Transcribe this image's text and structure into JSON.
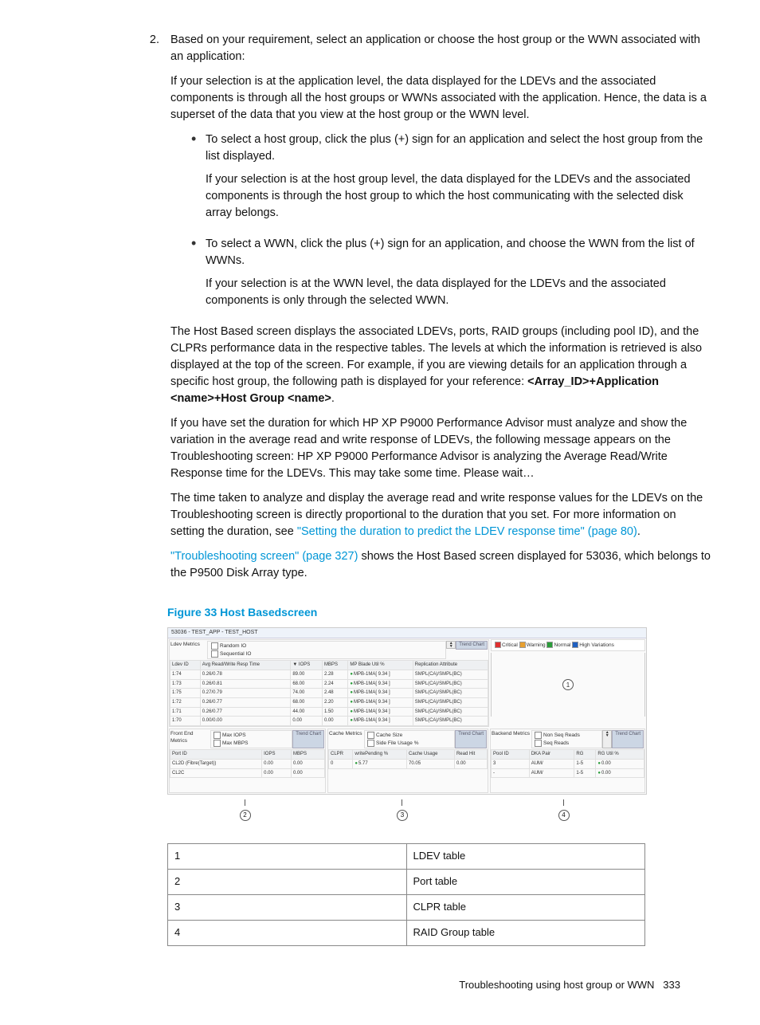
{
  "step_number": "2.",
  "step_text": "Based on your requirement, select an application or choose the host group or the WWN associated with an application:",
  "step_para1": "If your selection is at the application level, the data displayed for the LDEVs and the associated components is through all the host groups or WWNs associated with the application. Hence, the data is a superset of the data that you view at the host group or the WWN level.",
  "bullets": [
    {
      "lead": "To select a host group, click the plus (+) sign for an application and select the host group from the list displayed.",
      "sub": "If your selection is at the host group level, the data displayed for the LDEVs and the associated components is through the host group to which the host communicating with the selected disk array belongs."
    },
    {
      "lead": "To select a WWN, click the plus (+) sign for an application, and choose the WWN from the list of WWNs.",
      "sub": "If your selection is at the WWN level, the data displayed for the LDEVs and the associated components is only through the selected WWN."
    }
  ],
  "after1_a": "The Host Based screen displays the associated LDEVs, ports, RAID groups (including pool ID), and the CLPRs performance data in the respective tables. The levels at which the information is retrieved is also displayed at the top of the screen. For example, if you are viewing details for an application through a specific host group, the following path is displayed for your reference: ",
  "after1_b": "<Array_ID>+Application <name>+Host Group <name>",
  "after1_c": ".",
  "after2": "If you have set the duration for which HP XP P9000 Performance Advisor must analyze and show the variation in the average read and write response of LDEVs, the following message appears on the Troubleshooting screen: HP XP P9000 Performance Advisor is analyzing the Average Read/Write Response time for the LDEVs. This may take some time. Please wait…",
  "after3_a": "The time taken to analyze and display the average read and write response values for the LDEVs on the Troubleshooting screen is directly proportional to the duration that you set. For more information on setting the duration, see ",
  "after3_link": "\"Setting the duration to predict the LDEV response time\" (page 80)",
  "after3_b": ".",
  "after4_link": "\"Troubleshooting screen\" (page 327)",
  "after4_b": " shows the Host Based screen displayed for 53036, which belongs to the P9500 Disk Array type.",
  "figure_caption": "Figure 33 Host Basedscreen",
  "screenshot": {
    "title": "53036 - TEST_APP - TEST_HOST",
    "ldev": {
      "label": "Ldev Metrics",
      "chk1": "Random IO",
      "chk2": "Sequential IO",
      "btn": "Trend Chart",
      "headers": [
        "Ldev ID",
        "Avg Read/Write Resp Time",
        "▼ IOPS",
        "MBPS",
        "MP Blade Util %",
        "Replication Attribute"
      ],
      "rows": [
        [
          "1:74",
          "0.26/0.78",
          "89.00",
          "2.28",
          "MPB-1MA[ 9.34 ]",
          "SMPL(CA)/SMPL(BC)"
        ],
        [
          "1:73",
          "0.26/0.81",
          "68.00",
          "2.24",
          "MPB-1MA[ 9.34 ]",
          "SMPL(CA)/SMPL(BC)"
        ],
        [
          "1:75",
          "0.27/0.79",
          "74.00",
          "2.48",
          "MPB-1MA[ 9.34 ]",
          "SMPL(CA)/SMPL(BC)"
        ],
        [
          "1:72",
          "0.26/0.77",
          "68.00",
          "2.20",
          "MPB-1MA[ 9.34 ]",
          "SMPL(CA)/SMPL(BC)"
        ],
        [
          "1:71",
          "0.26/0.77",
          "44.00",
          "1.50",
          "MPB-1MA[ 9.34 ]",
          "SMPL(CA)/SMPL(BC)"
        ],
        [
          "1:70",
          "0.00/0.00",
          "0.00",
          "0.00",
          "MPB-1MA[ 9.34 ]",
          "SMPL(CA)/SMPL(BC)"
        ]
      ]
    },
    "legend": {
      "crit": "Critical",
      "warn": "Warning",
      "norm": "Normal",
      "high": "High Variations"
    },
    "front": {
      "label": "Front End Metrics",
      "chk1": "Max IOPS",
      "chk2": "Max MBPS",
      "btn": "Trend Chart",
      "headers": [
        "Port ID",
        "IOPS",
        "MBPS"
      ],
      "rows": [
        [
          "CL2D (Fibre(Target))",
          "0.00",
          "0.00"
        ],
        [
          "CL2C",
          "0.00",
          "0.00"
        ]
      ]
    },
    "cache": {
      "label": "Cache Metrics",
      "chk1": "Cache Size",
      "chk2": "Side File Usage %",
      "btn": "Trend Chart",
      "headers": [
        "CLPR",
        "writePending %",
        "Cache Usage",
        "Read Hit"
      ],
      "rows": [
        [
          "0",
          "5.77",
          "70.05",
          "0.00"
        ]
      ]
    },
    "backend": {
      "label": "Backend Metrics",
      "chk1": "Non Seq Reads",
      "chk2": "Seq Reads",
      "btn": "Trend Chart",
      "headers": [
        "Pool ID",
        "DKA Pair",
        "RG",
        "RG Util %"
      ],
      "rows": [
        [
          "3",
          "AUM/",
          "1-5",
          "0.00"
        ],
        [
          "-",
          "AUM/",
          "1-5",
          "0.00"
        ]
      ]
    },
    "callouts": [
      "1",
      "2",
      "3",
      "4"
    ]
  },
  "legend_table": [
    [
      "1",
      "LDEV table"
    ],
    [
      "2",
      "Port table"
    ],
    [
      "3",
      "CLPR table"
    ],
    [
      "4",
      "RAID Group table"
    ]
  ],
  "footer": {
    "title": "Troubleshooting using host group or WWN",
    "page": "333"
  }
}
